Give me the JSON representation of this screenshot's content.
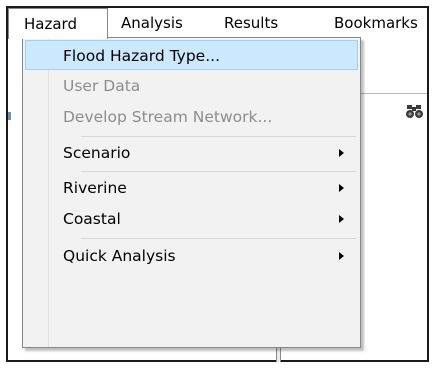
{
  "menubar": {
    "items": [
      {
        "label": "Hazard"
      },
      {
        "label": "Analysis"
      },
      {
        "label": "Results"
      },
      {
        "label": "Bookmarks"
      }
    ],
    "active_index": 0
  },
  "dropdown": {
    "items": [
      {
        "label": "Flood Hazard Type...",
        "state": "highlighted",
        "submenu": false
      },
      {
        "label": "User Data",
        "state": "disabled",
        "submenu": false
      },
      {
        "label": "Develop Stream Network...",
        "state": "disabled",
        "submenu": false
      },
      {
        "label": "Scenario",
        "state": "enabled",
        "submenu": true
      },
      {
        "label": "Riverine",
        "state": "enabled",
        "submenu": true
      },
      {
        "label": "Coastal",
        "state": "enabled",
        "submenu": true
      },
      {
        "label": "Quick Analysis",
        "state": "enabled",
        "submenu": true
      }
    ]
  },
  "background": {
    "toolbar_icon": "binoculars-icon"
  },
  "colors": {
    "highlight_fill": "#cce8ff",
    "highlight_border": "#99d1ff",
    "disabled_text": "#8d8d8d",
    "menu_background": "#f2f2f2"
  }
}
